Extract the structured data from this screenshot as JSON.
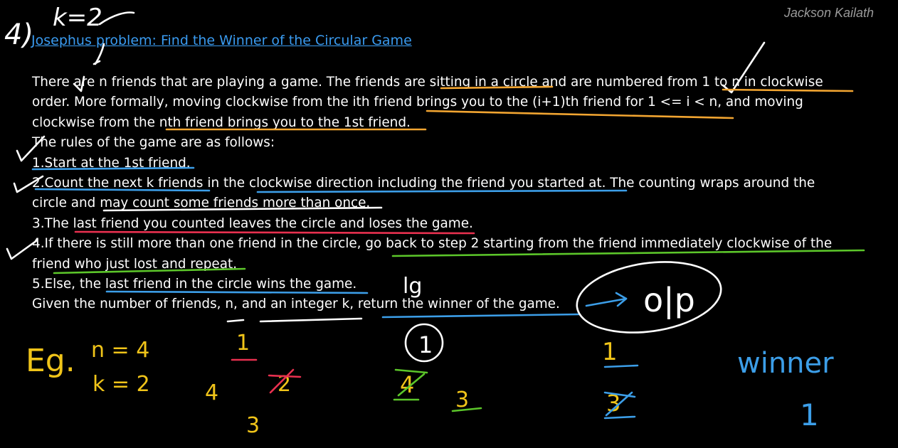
{
  "author": "Jackson Kailath",
  "title_link": "Josephus problem: Find the Winner of the Circular Game",
  "paragraph": [
    "There are n friends that are playing a game. The friends are sitting in a circle and are numbered from 1 to n in clockwise",
    "order. More formally, moving clockwise from the ith friend brings you to the (i+1)th friend for 1 <= i < n, and moving",
    "clockwise from the nth friend brings you to the 1st friend.",
    "The rules of the game are as follows:",
    "1.Start at the 1st friend.",
    "2.Count the next k friends in the clockwise direction including the friend you started at. The counting wraps around the",
    "circle and may count some friends more than once.",
    "3.The last friend you counted leaves the circle and loses the game.",
    "4.If there is still more than one friend in the circle, go back to step 2 starting from the friend immediately clockwise of the",
    "friend who just lost and repeat.",
    "5.Else, the last friend in the circle wins the game.",
    "Given the number of friends, n, and an integer k, return the winner of the game."
  ],
  "handwriting": {
    "question_number": "4)",
    "k_note": "k=2",
    "eg_label": "Eg.",
    "n_value": "n = 4",
    "k_value": "k = 2",
    "lg_note": "lg",
    "op_note": "o|p",
    "winner_label": "winner",
    "winner_value": "1",
    "round1": {
      "top": "1",
      "right": "2",
      "left": "4",
      "bottom": "3"
    },
    "round2": {
      "circled": "1",
      "crossed": "4",
      "remaining": "3"
    },
    "round3": {
      "top": "1",
      "crossed": "3"
    }
  },
  "colors": {
    "background": "#000000",
    "text": "#ffffff",
    "link": "#3a9bf0",
    "author": "#9a9a9a",
    "ink_white": "#ffffff",
    "ink_orange": "#f2a531",
    "ink_blue": "#3c9ee8",
    "ink_red": "#e8304f",
    "ink_green": "#5cc62a",
    "ink_yellow": "#f0c419"
  }
}
